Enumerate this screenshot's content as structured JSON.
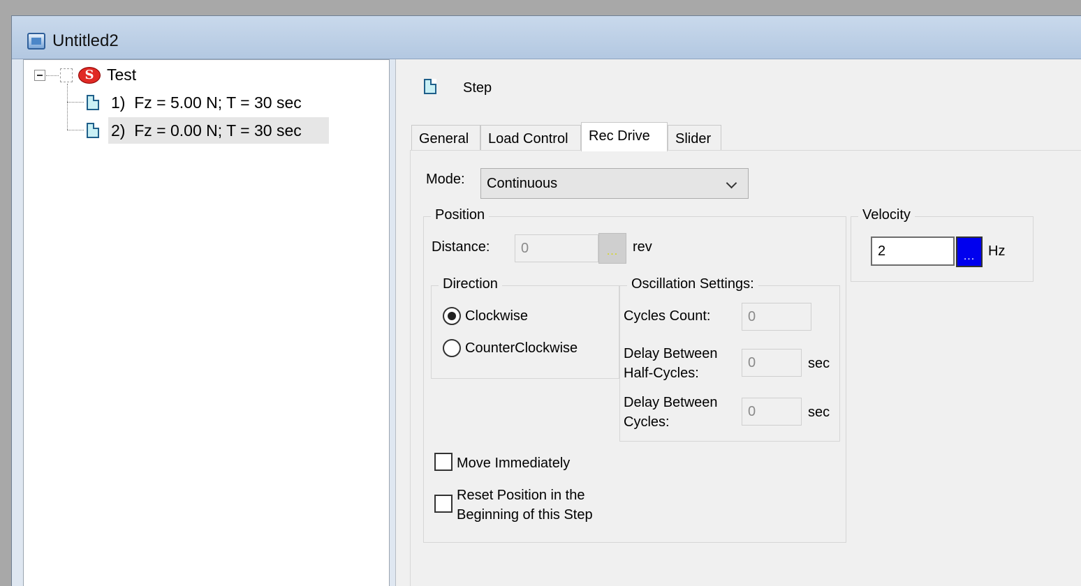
{
  "window": {
    "title": "Untitled2"
  },
  "tree": {
    "root": {
      "label": "Test",
      "icon": "s-badge-icon"
    },
    "items": [
      {
        "label": "1)  Fz = 5.00 N; T = 30 sec"
      },
      {
        "label": "2)  Fz = 0.00 N; T = 30 sec",
        "selected": true
      }
    ]
  },
  "panel": {
    "header": "Step",
    "tabs": [
      {
        "label": "General"
      },
      {
        "label": "Load Control"
      },
      {
        "label": "Rec Drive",
        "active": true
      },
      {
        "label": "Slider"
      }
    ],
    "mode": {
      "label": "Mode:",
      "value": "Continuous"
    },
    "position": {
      "title": "Position",
      "distance_label": "Distance:",
      "distance_value": "0",
      "distance_unit": "rev",
      "dots": "..."
    },
    "direction": {
      "title": "Direction",
      "clockwise": "Clockwise",
      "counterclockwise": "CounterClockwise",
      "selected": "Clockwise"
    },
    "oscillation": {
      "title": "Oscillation Settings:",
      "cycles_label": "Cycles Count:",
      "cycles_value": "0",
      "half_delay_label_1": "Delay Between",
      "half_delay_label_2": "Half-Cycles:",
      "half_delay_value": "0",
      "half_delay_unit": "sec",
      "cycle_delay_label_1": "Delay Between",
      "cycle_delay_label_2": "Cycles:",
      "cycle_delay_value": "0",
      "cycle_delay_unit": "sec"
    },
    "move_immediately": "Move Immediately",
    "reset_position_1": "Reset Position in the",
    "reset_position_2": "Beginning of this Step",
    "velocity": {
      "title": "Velocity",
      "value": "2",
      "unit": "Hz",
      "dots": "..."
    }
  }
}
